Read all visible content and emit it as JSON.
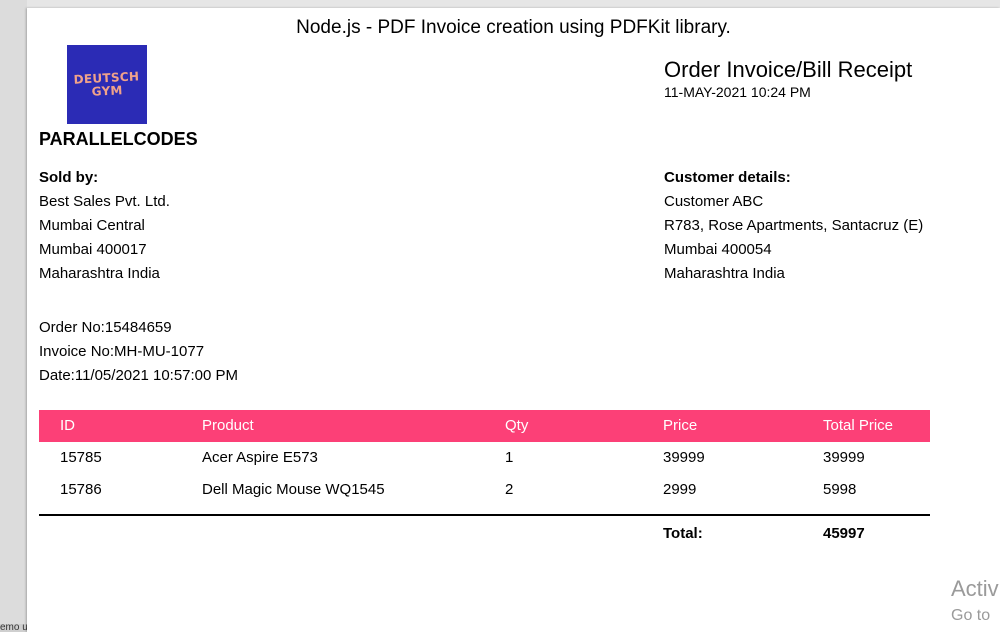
{
  "page_title": "Node.js - PDF Invoice creation using PDFKit library.",
  "logo_text": "DEUTSCH\nGYM",
  "company_name": "PARALLELCODES",
  "doc_heading": "Order Invoice/Bill Receipt",
  "doc_date": "11-MAY-2021 10:24 PM",
  "seller": {
    "label": "Sold by:",
    "lines": [
      "Best Sales Pvt. Ltd.",
      "Mumbai Central",
      "Mumbai 400017",
      "Maharashtra India"
    ]
  },
  "customer": {
    "label": "Customer details:",
    "lines": [
      "Customer ABC",
      "R783, Rose Apartments, Santacruz (E)",
      "Mumbai 400054",
      "Maharashtra India"
    ]
  },
  "order_info": {
    "order_no": "Order No:15484659",
    "invoice_no": "Invoice No:MH-MU-1077",
    "date": "Date:11/05/2021 10:57:00 PM"
  },
  "table": {
    "headers": [
      "ID",
      "Product",
      "Qty",
      "Price",
      "Total Price"
    ],
    "rows": [
      [
        "15785",
        "Acer Aspire E573",
        "1",
        "39999",
        "39999"
      ],
      [
        "15786",
        "Dell Magic Mouse WQ1545",
        "2",
        "2999",
        "5998"
      ]
    ],
    "total_label": "Total:",
    "total_value": "45997",
    "header_color": "#fc4077"
  },
  "left_edge_text": "emo use",
  "watermark": {
    "line1": "Activ",
    "line2": "Go to"
  }
}
